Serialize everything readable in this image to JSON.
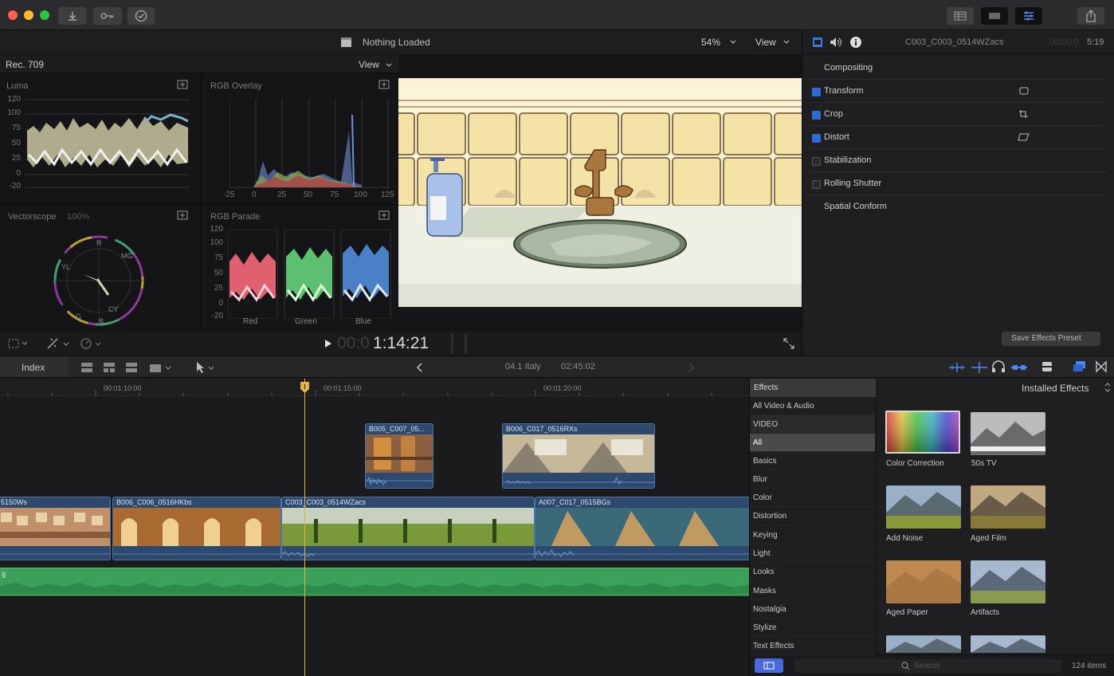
{
  "toolbar": {
    "icons": [
      "import-icon",
      "keyword-icon",
      "checkmark-icon",
      "library-layout-icon",
      "viewer-layout-icon",
      "inspector-layout-icon",
      "share-icon"
    ]
  },
  "viewer": {
    "clapper_icon": "clapper-icon",
    "title": "Nothing Loaded",
    "zoom": "54%",
    "view_label": "View",
    "timecode_dim": "00:0",
    "timecode": "1:14:21"
  },
  "scopes": {
    "colorspace": "Rec. 709",
    "view_label": "View",
    "luma": {
      "label": "Luma",
      "ticks": [
        "120",
        "100",
        "75",
        "50",
        "25",
        "0",
        "-20"
      ]
    },
    "rgb_overlay": {
      "label": "RGB Overlay",
      "xticks": [
        "-25",
        "0",
        "25",
        "50",
        "75",
        "100",
        "125"
      ]
    },
    "vectorscope": {
      "label": "Vectorscope",
      "value": "100%",
      "marks": [
        "R",
        "MG",
        "YL",
        "CY",
        "G",
        "B"
      ]
    },
    "rgb_parade": {
      "label": "RGB Parade",
      "ticks": [
        "120",
        "100",
        "75",
        "50",
        "25",
        "0",
        "-20"
      ],
      "channels": [
        "Red",
        "Green",
        "Blue"
      ]
    }
  },
  "inspector": {
    "clip_name": "C003_C003_0514WZacs",
    "tc_dim": "00:00:0",
    "tc": "5:19",
    "rows": [
      {
        "label": "Compositing",
        "checkbox": null
      },
      {
        "label": "Transform",
        "checkbox": true
      },
      {
        "label": "Crop",
        "checkbox": true
      },
      {
        "label": "Distort",
        "checkbox": true
      },
      {
        "label": "Stabilization",
        "checkbox": false
      },
      {
        "label": "Rolling Shutter",
        "checkbox": false
      },
      {
        "label": "Spatial Conform",
        "checkbox": null
      }
    ],
    "save_preset": "Save Effects Preset"
  },
  "timeline_bar": {
    "index": "Index",
    "project": "04.1 Italy",
    "duration": "02:45:02"
  },
  "timeline": {
    "ruler": [
      "00:01:10:00",
      "00:01:15:00",
      "00:01:20:00"
    ],
    "connected_clips": [
      "B005_C007_05...",
      "B006_C017_0516RXs"
    ],
    "primary_clips": [
      "5150Ws",
      "B006_C006_0516HKbs",
      "C003_C003_0514WZacs",
      "A007_C017_0515BGs"
    ],
    "audio_label": "g"
  },
  "effects": {
    "header": "Effects",
    "installed": "Installed Effects",
    "categories": [
      "All Video & Audio",
      "VIDEO",
      "All",
      "Basics",
      "Blur",
      "Color",
      "Distortion",
      "Keying",
      "Light",
      "Looks",
      "Masks",
      "Nostalgia",
      "Stylize",
      "Text Effects"
    ],
    "items": [
      "Color Correction",
      "50s TV",
      "Add Noise",
      "Aged Film",
      "Aged Paper",
      "Artifacts"
    ],
    "search_placeholder": "Search",
    "count": "124 items"
  },
  "colors": {
    "accent_blue": "#2f6bd7",
    "playhead": "#e2b43a",
    "clip_blue": "#2d4a6e",
    "audio_green": "#3aa05a"
  }
}
